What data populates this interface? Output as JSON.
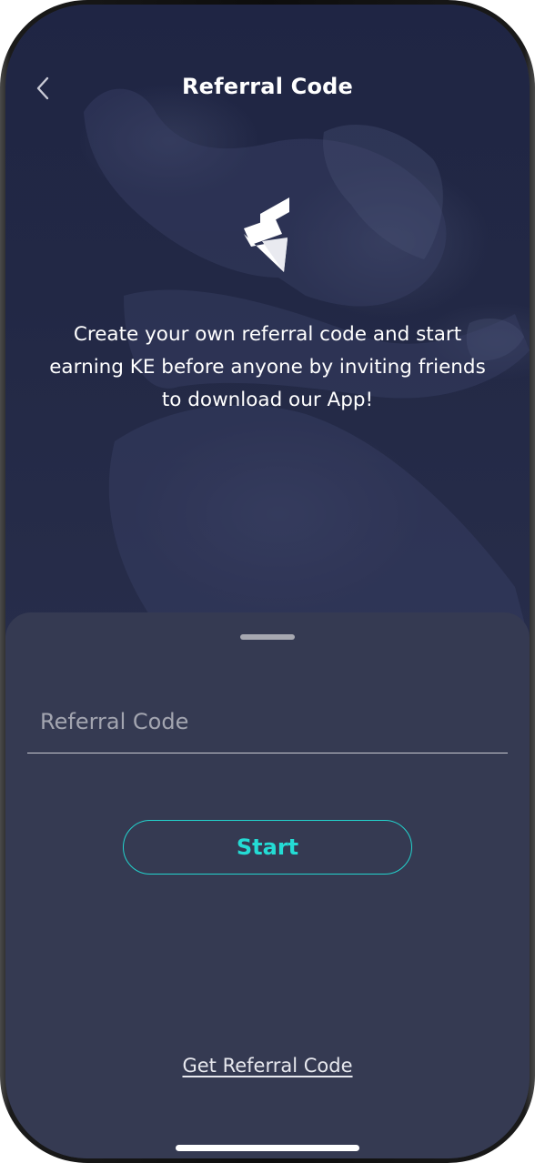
{
  "header": {
    "title": "Referral Code",
    "back_icon": "chevron-left-icon"
  },
  "hero": {
    "logo_icon": "brand-logo",
    "intro_text": "Create your own referral code and start earning KE before anyone by inviting friends to download our App!"
  },
  "sheet": {
    "referral_input": {
      "value": "",
      "placeholder": "Referral Code"
    },
    "start_label": "Start",
    "get_referral_link": "Get Referral Code"
  },
  "colors": {
    "accent": "#23d3cd",
    "hero_background": "#222845",
    "sheet_background": "#353a52",
    "text_primary": "#ffffff",
    "placeholder": "#a3a5b0"
  }
}
